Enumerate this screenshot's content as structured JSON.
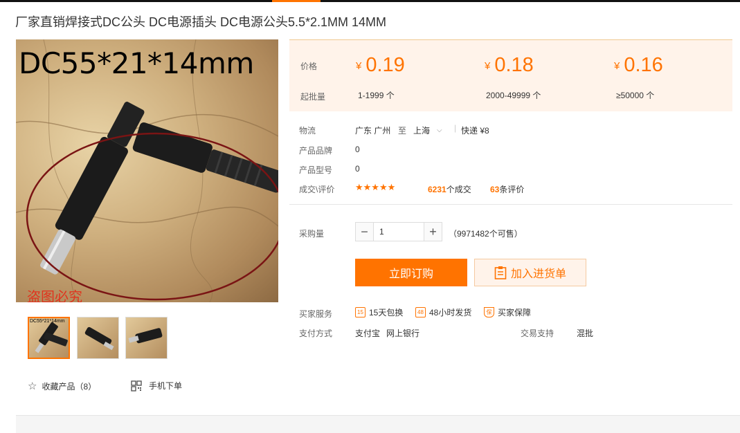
{
  "product": {
    "title": "厂家直销焊接式DC公头 DC电源插头 DC电源公头5.5*2.1MM 14MM",
    "image_overlay": "DC55*21*14mm",
    "image_watermark": "盗图必究",
    "thumb_label": "DC55*21*14mm"
  },
  "actions": {
    "favorite_label": "收藏产品（8）",
    "mobile_label": "手机下单"
  },
  "pricing": {
    "price_label": "价格",
    "batch_label": "起批量",
    "currency": "¥",
    "tiers": [
      {
        "price": "0.19",
        "range": "1-1999 个"
      },
      {
        "price": "0.18",
        "range": "2000-49999 个"
      },
      {
        "price": "0.16",
        "range": "≥50000 个"
      }
    ]
  },
  "logistics": {
    "label": "物流",
    "from": "广东 广州",
    "to_word": "至",
    "to": "上海",
    "shipping": "快递 ¥8"
  },
  "brand": {
    "label": "产品品牌",
    "value": "0"
  },
  "model": {
    "label": "产品型号",
    "value": "0"
  },
  "reviews": {
    "label": "成交\\评价",
    "stars": "★★★★★",
    "deals_count": "6231",
    "deals_suffix": "个成交",
    "review_count": "63",
    "review_suffix": "条评价"
  },
  "purchase": {
    "label": "采购量",
    "quantity": "1",
    "stock": "（9971482个可售）",
    "order_button": "立即订购",
    "cart_button": "加入进货单"
  },
  "services": {
    "label": "买家服务",
    "items": [
      {
        "icon_text": "15",
        "text": "15天包换"
      },
      {
        "icon_text": "48",
        "text": "48小时发货"
      },
      {
        "icon_text": "保",
        "text": "买家保障"
      }
    ]
  },
  "payment": {
    "label": "支付方式",
    "methods": [
      "支付宝",
      "网上银行"
    ],
    "trade_label": "交易支持",
    "trade_value": "混批"
  },
  "colors": {
    "accent": "#ff7300",
    "price_bg": "#fff3ea"
  }
}
